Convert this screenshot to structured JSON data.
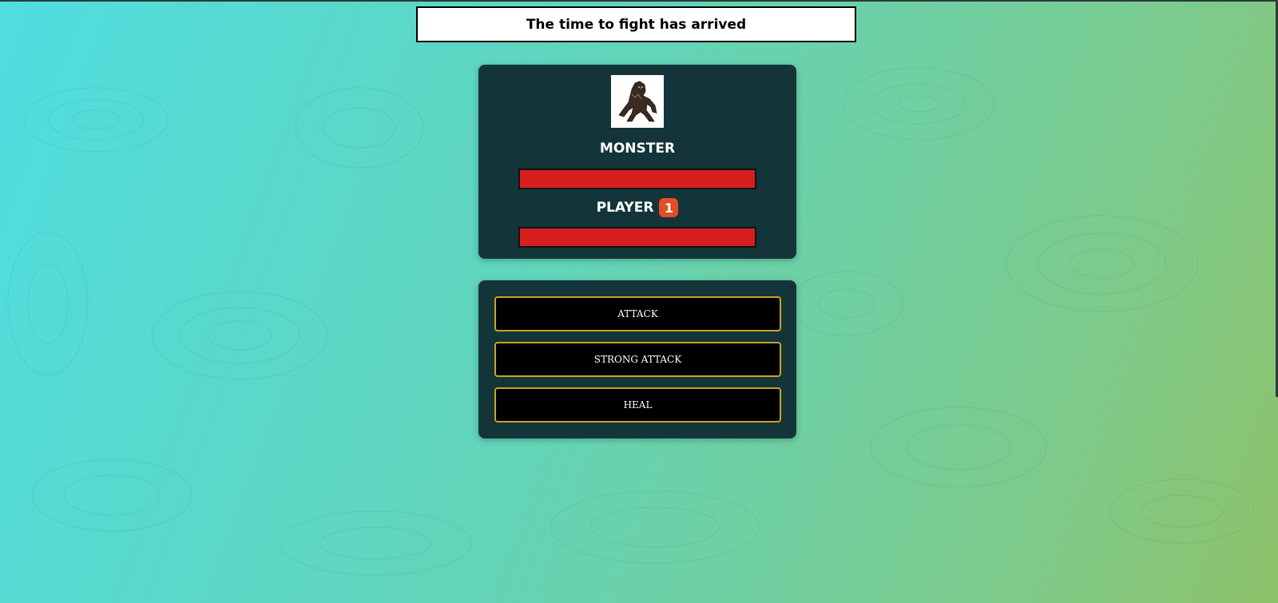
{
  "header": {
    "title": "The time to fight has arrived"
  },
  "monster": {
    "name": "MONSTER",
    "health": 1.0,
    "image_icon": "werewolf-monster-image"
  },
  "player": {
    "name": "PLAYER",
    "bonus_lives": "1",
    "health": 1.0
  },
  "controls": {
    "attack_label": "ATTACK",
    "strong_attack_label": "STRONG ATTACK",
    "heal_label": "HEAL"
  },
  "colors": {
    "panel": "#133539",
    "health_fill": "#d81f1f",
    "badge": "#e24f23",
    "button_border": "#c8a522",
    "button_bg": "#000000"
  }
}
